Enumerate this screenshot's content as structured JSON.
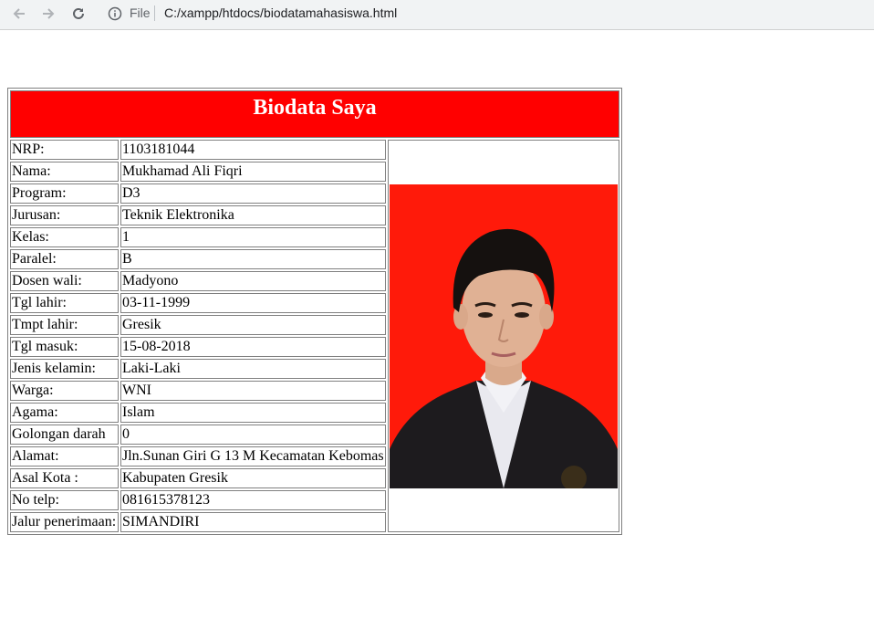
{
  "browser": {
    "file_label": "File",
    "url": "C:/xampp/htdocs/biodatamahasiswa.html"
  },
  "page": {
    "title": "Biodata Saya",
    "rows": [
      {
        "label": "NRP:",
        "value": "1103181044"
      },
      {
        "label": "Nama:",
        "value": "Mukhamad Ali Fiqri"
      },
      {
        "label": "Program:",
        "value": "D3"
      },
      {
        "label": "Jurusan:",
        "value": "Teknik Elektronika"
      },
      {
        "label": "Kelas:",
        "value": "1"
      },
      {
        "label": "Paralel:",
        "value": "B"
      },
      {
        "label": "Dosen wali:",
        "value": "Madyono"
      },
      {
        "label": "Tgl lahir:",
        "value": "03-11-1999"
      },
      {
        "label": "Tmpt lahir:",
        "value": "Gresik"
      },
      {
        "label": "Tgl masuk:",
        "value": "15-08-2018"
      },
      {
        "label": "Jenis kelamin:",
        "value": "Laki-Laki"
      },
      {
        "label": "Warga:",
        "value": "WNI"
      },
      {
        "label": "Agama:",
        "value": "Islam"
      },
      {
        "label": "Golongan darah",
        "value": "0"
      },
      {
        "label": "Alamat:",
        "value": "Jln.Sunan Giri G 13 M Kecamatan Kebomas"
      },
      {
        "label": "Asal Kota :",
        "value": "Kabupaten Gresik"
      },
      {
        "label": "No telp:",
        "value": "081615378123"
      },
      {
        "label": "Jalur penerimaan:",
        "value": "SIMANDIRI"
      }
    ]
  },
  "colors": {
    "header_bg": "#ff0000",
    "header_text": "#ffffff",
    "photo_bg": "#ff1a0a"
  }
}
